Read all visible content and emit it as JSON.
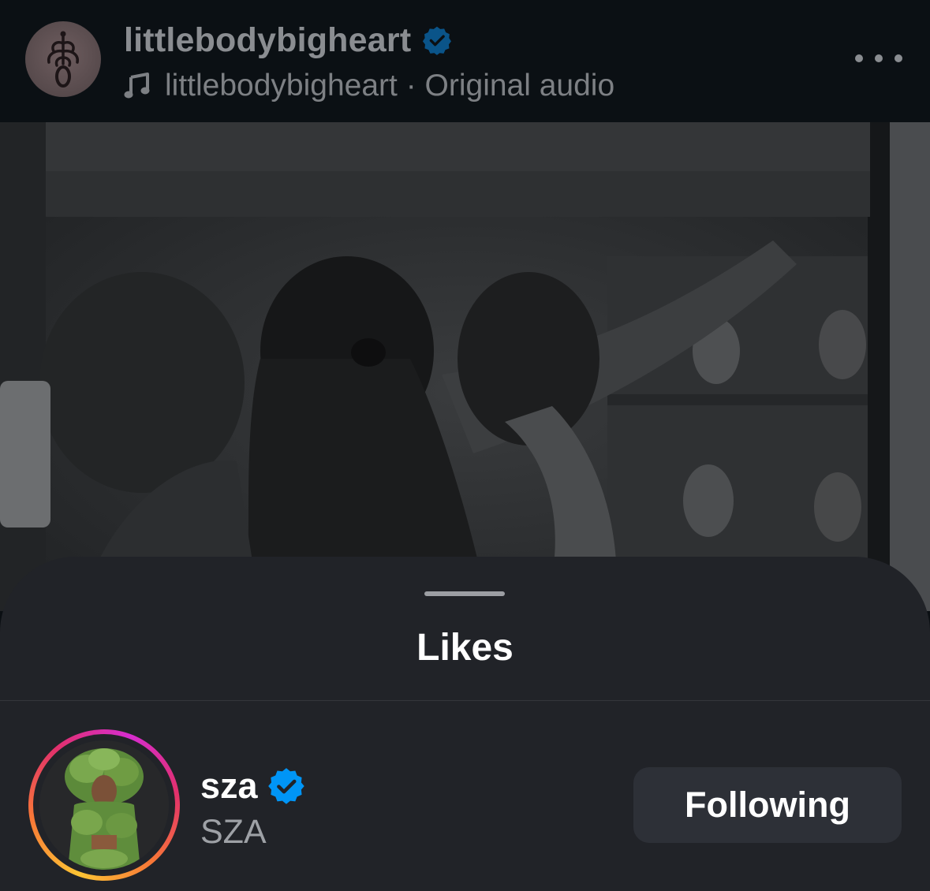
{
  "post": {
    "owner_username": "littlebodybigheart",
    "owner_verified": true,
    "audio_label": "littlebodybigheart · Original audio",
    "icons": {
      "avatar": "tree-logo-avatar",
      "verified": "verified-badge-icon",
      "audio": "music-note-icon",
      "more": "more-horizontal-icon"
    }
  },
  "likes_sheet": {
    "title": "Likes",
    "users": [
      {
        "username": "sza",
        "full_name": "SZA",
        "verified": true,
        "has_story_ring": true,
        "button_label": "Following"
      }
    ]
  },
  "colors": {
    "verified_blue": "#0095f6",
    "sheet_background": "#212328",
    "button_background": "#2d3037",
    "story_ring": [
      "#fdc434",
      "#f77737",
      "#e1306c",
      "#d62dcf"
    ]
  }
}
